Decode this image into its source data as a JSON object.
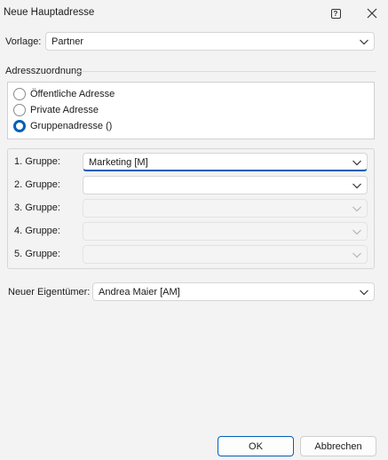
{
  "window": {
    "title": "Neue Hauptadresse",
    "help_glyph": "?"
  },
  "vorlage": {
    "label": "Vorlage:",
    "value": "Partner"
  },
  "section": {
    "label": "Adresszuordnung"
  },
  "radios": [
    {
      "label": "Öffentliche Adresse",
      "checked": false
    },
    {
      "label": "Private Adresse",
      "checked": false
    },
    {
      "label": "Gruppenadresse ()",
      "checked": true
    }
  ],
  "groups": [
    {
      "label": "1. Gruppe:",
      "value": "Marketing [M]",
      "state": "focused"
    },
    {
      "label": "2. Gruppe:",
      "value": "",
      "state": "enabled"
    },
    {
      "label": "3. Gruppe:",
      "value": "",
      "state": "disabled"
    },
    {
      "label": "4. Gruppe:",
      "value": "",
      "state": "disabled"
    },
    {
      "label": "5. Gruppe:",
      "value": "",
      "state": "disabled"
    }
  ],
  "owner": {
    "label": "Neuer Eigentümer:",
    "value": "Andrea Maier [AM]"
  },
  "buttons": {
    "ok": "OK",
    "cancel": "Abbrechen"
  },
  "colors": {
    "accent": "#005fb8",
    "background": "#f3f3f3"
  },
  "icons": {
    "help": "help-icon",
    "close": "close-icon",
    "dropdown": "chevron-down-icon"
  }
}
